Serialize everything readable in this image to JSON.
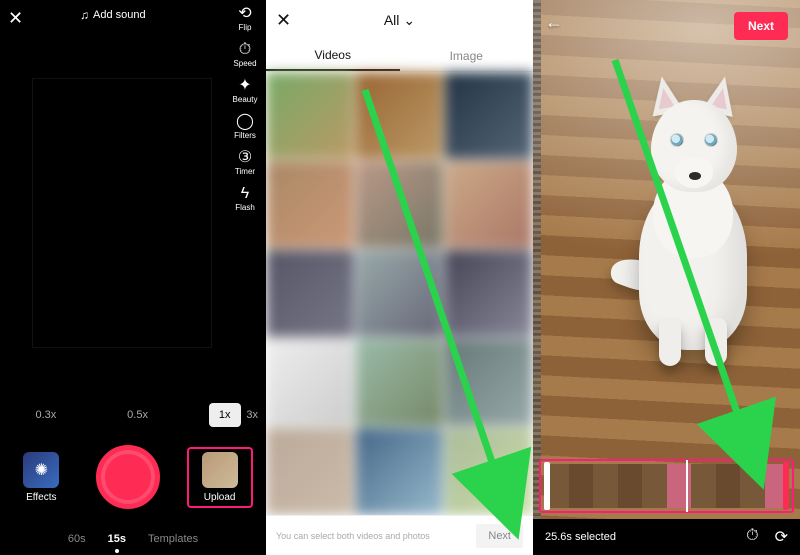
{
  "camera": {
    "add_sound": "Add sound",
    "tools": {
      "flip": "Flip",
      "speed": "Speed",
      "beauty": "Beauty",
      "filters": "Filters",
      "timer": "Timer",
      "flash": "Flash"
    },
    "zoom": {
      "x03": "0.3x",
      "x05": "0.5x",
      "x1": "1x",
      "x3": "3x"
    },
    "effects": "Effects",
    "upload": "Upload",
    "modes": {
      "m60": "60s",
      "m15": "15s",
      "templates": "Templates"
    }
  },
  "gallery": {
    "all": "All",
    "tab_videos": "Videos",
    "tab_image": "Image",
    "hint": "You can select both videos and photos",
    "next": "Next"
  },
  "trim": {
    "next": "Next",
    "selected": "25.6s selected"
  }
}
